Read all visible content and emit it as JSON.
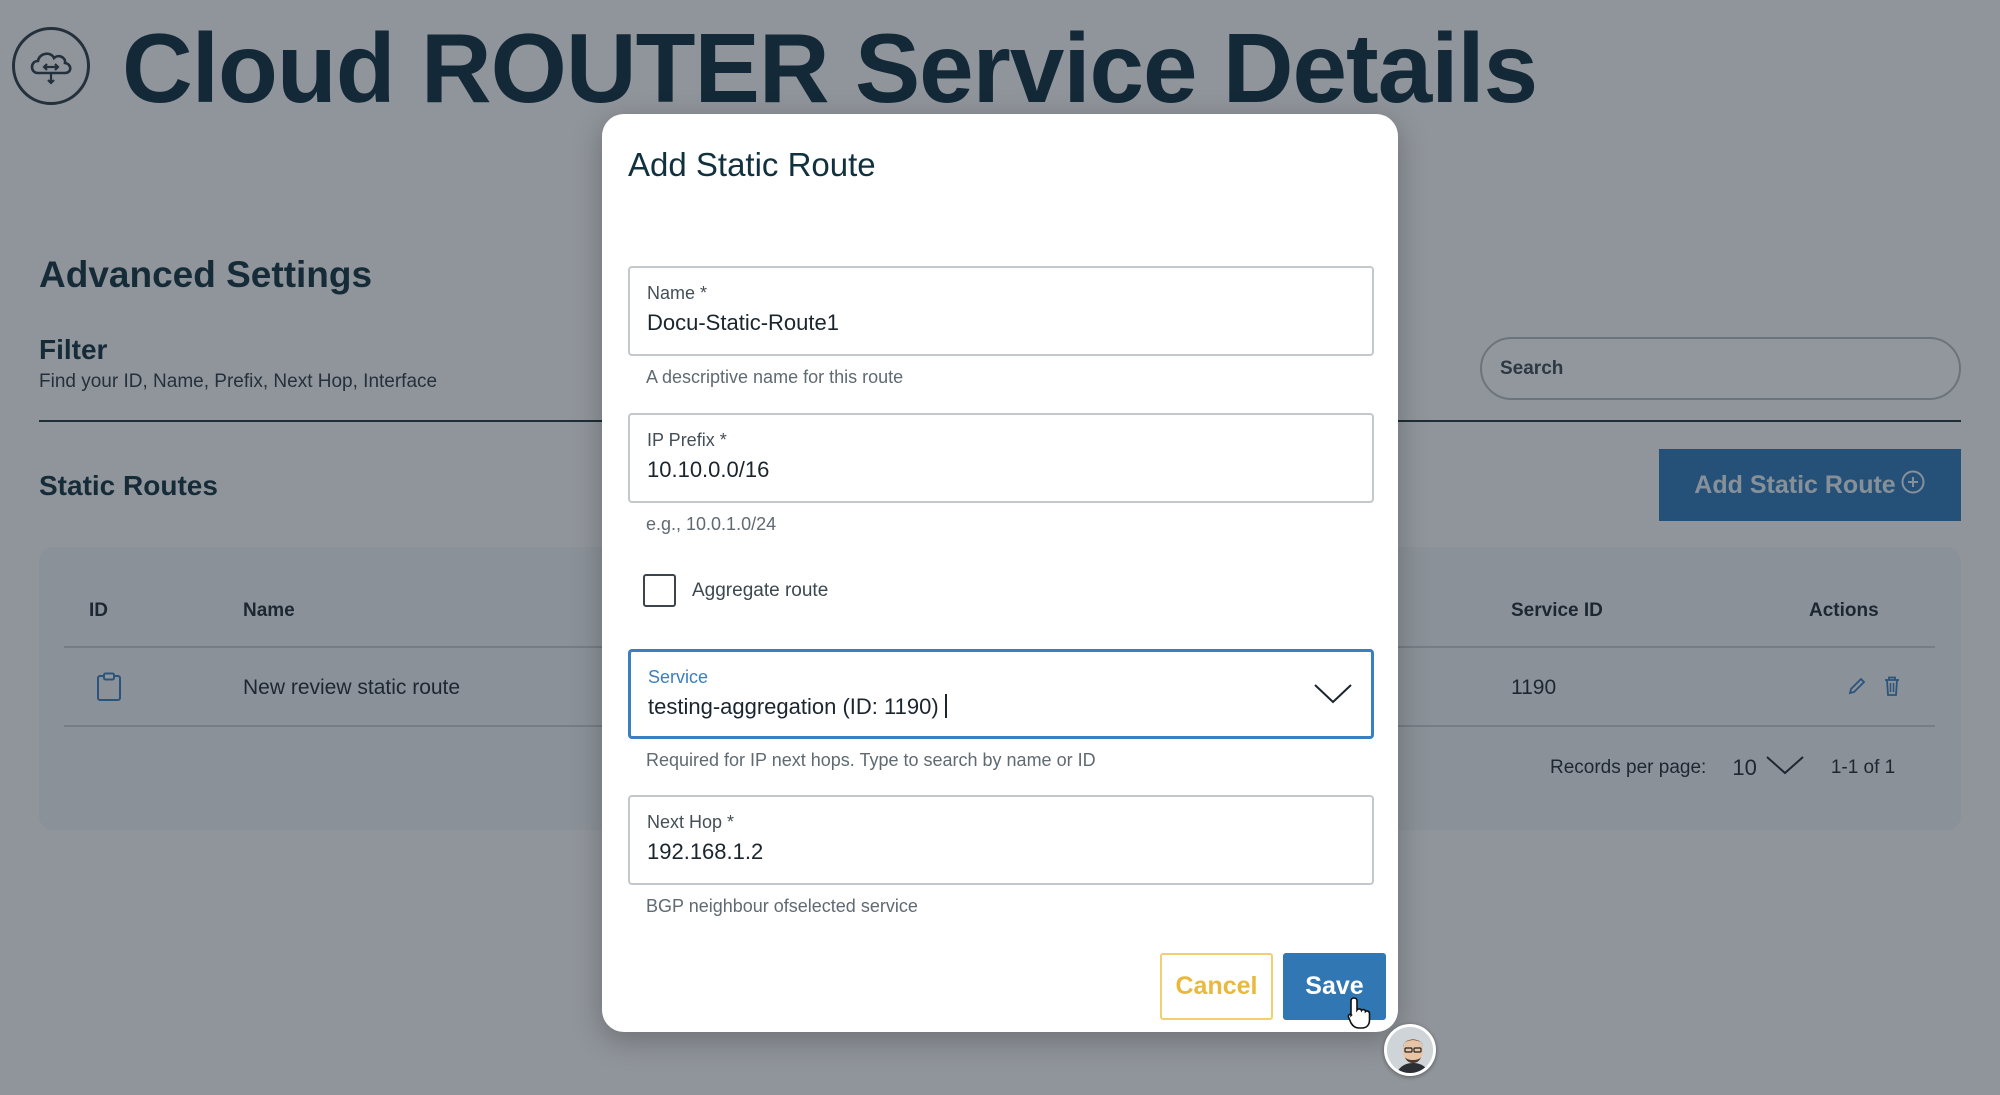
{
  "page": {
    "title": "Cloud ROUTER Service Details",
    "section_title": "Advanced Settings",
    "filter": {
      "title": "Filter",
      "subtitle": "Find your ID, Name, Prefix, Next Hop, Interface",
      "search_placeholder": "Search"
    },
    "routes": {
      "title": "Static Routes",
      "add_button_label": "Add Static Route",
      "columns": {
        "id": "ID",
        "name": "Name",
        "service_id": "Service ID",
        "actions": "Actions"
      },
      "rows": [
        {
          "name": "New review static route",
          "service_id": "1190"
        }
      ],
      "records_per_page_label": "Records per page:",
      "records_per_page_value": "10",
      "range": "1-1 of 1"
    }
  },
  "modal": {
    "title": "Add Static Route",
    "name_field": {
      "label": "Name *",
      "value": "Docu-Static-Route1",
      "helper": "A descriptive name for this route"
    },
    "prefix_field": {
      "label": "IP Prefix *",
      "value": "10.10.0.0/16",
      "helper": "e.g., 10.0.1.0/24"
    },
    "aggregate": {
      "label": "Aggregate route",
      "checked": false
    },
    "service_field": {
      "label": "Service",
      "value": "testing-aggregation (ID: 1190)",
      "helper": "Required for IP next hops. Type to search by name or ID"
    },
    "next_hop_field": {
      "label": "Next Hop *",
      "value": "192.168.1.2",
      "helper": "BGP neighbour ofselected service"
    },
    "cancel_label": "Cancel",
    "save_label": "Save"
  },
  "colors": {
    "primary": "#3177b3",
    "cancel_accent": "#e9b93d",
    "focus_border": "#3a7fc0",
    "title_text": "#0f2d3c"
  },
  "icons": [
    "cloud-router-icon",
    "plus-circle-icon",
    "clipboard-icon",
    "pencil-icon",
    "trash-icon",
    "chevron-down-icon",
    "pointer-cursor-icon"
  ]
}
